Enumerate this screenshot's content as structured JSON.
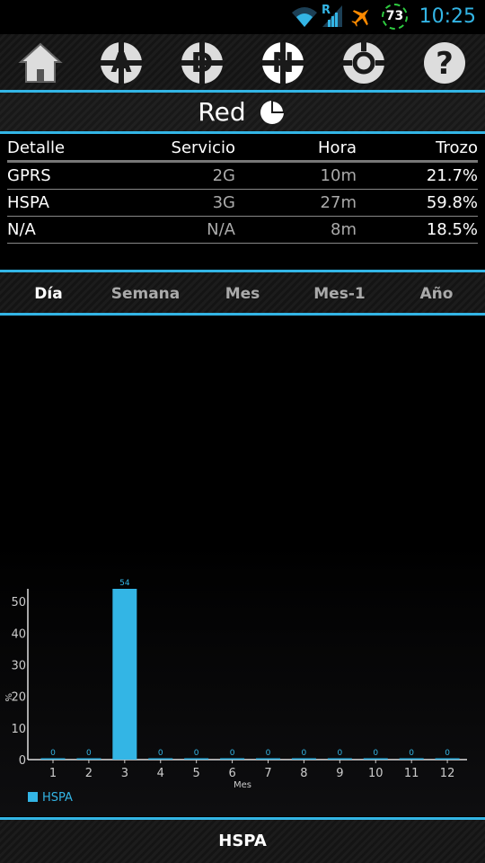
{
  "status_bar": {
    "time": "10:25",
    "badge": "73",
    "roaming_indicator": "R",
    "icons": [
      "wifi-icon",
      "signal-icon",
      "airplane-icon",
      "badge-icon"
    ]
  },
  "toolbar": {
    "buttons": [
      {
        "name": "home-icon"
      },
      {
        "name": "a-icon",
        "letter": "A"
      },
      {
        "name": "d-icon",
        "letter": "D"
      },
      {
        "name": "n-icon",
        "letter": "N"
      },
      {
        "name": "ring-icon"
      },
      {
        "name": "help-icon",
        "letter": "?"
      }
    ]
  },
  "title": "Red",
  "table": {
    "headers": [
      "Detalle",
      "Servicio",
      "Hora",
      "Trozo"
    ],
    "rows": [
      [
        "GPRS",
        "2G",
        "10m",
        "21.7%"
      ],
      [
        "HSPA",
        "3G",
        "27m",
        "59.8%"
      ],
      [
        "N/A",
        "N/A",
        "8m",
        "18.5%"
      ]
    ]
  },
  "tabs": [
    {
      "label": "Día",
      "active": true
    },
    {
      "label": "Semana",
      "active": false
    },
    {
      "label": "Mes",
      "active": false
    },
    {
      "label": "Mes-1",
      "active": false
    },
    {
      "label": "Año",
      "active": false
    }
  ],
  "chart_data": {
    "type": "bar",
    "categories": [
      "1",
      "2",
      "3",
      "4",
      "5",
      "6",
      "7",
      "8",
      "9",
      "10",
      "11",
      "12"
    ],
    "series": [
      {
        "name": "HSPA",
        "values": [
          0,
          0,
          54,
          0,
          0,
          0,
          0,
          0,
          0,
          0,
          0,
          0
        ],
        "color": "#33b5e5"
      }
    ],
    "value_labels": [
      "0",
      "0",
      "54",
      "0",
      "0",
      "0",
      "0",
      "0",
      "0",
      "0",
      "0",
      "0"
    ],
    "xlabel": "Mes",
    "ylabel": "%",
    "yticks": [
      "0",
      "10",
      "20",
      "30",
      "40",
      "50"
    ],
    "ylim": [
      0,
      54
    ],
    "legend": "bottom-left"
  },
  "bottom_label": "HSPA",
  "colors": {
    "accent": "#33b5e5",
    "badge_ring": "#2ecc40",
    "airplane": "#ff8a00"
  }
}
